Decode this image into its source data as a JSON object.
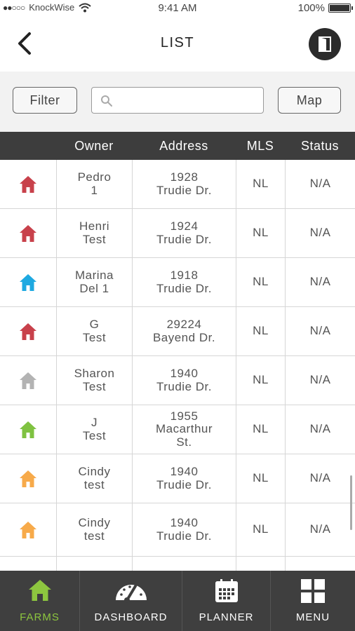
{
  "status_bar": {
    "signal": "●●○○○",
    "carrier": "KnockWise",
    "time": "9:41 AM",
    "battery": "100%"
  },
  "nav": {
    "title": "LIST",
    "back_icon": "chevron-left-icon",
    "action_icon": "door-icon"
  },
  "toolbar": {
    "filter_label": "Filter",
    "search_placeholder": "",
    "search_value": "",
    "map_label": "Map"
  },
  "table": {
    "columns": [
      "",
      "Owner",
      "Address",
      "MLS",
      "Status"
    ],
    "rows": [
      {
        "color": "#c8414b",
        "owner": "Pedro\n1",
        "address": "1928\nTrudie Dr.",
        "mls": "NL",
        "status": "N/A"
      },
      {
        "color": "#c8414b",
        "owner": "Henri\nTest",
        "address": "1924\nTrudie Dr.",
        "mls": "NL",
        "status": "N/A"
      },
      {
        "color": "#1ea9e1",
        "owner": "Marina\nDel 1",
        "address": "1918\nTrudie Dr.",
        "mls": "NL",
        "status": "N/A"
      },
      {
        "color": "#c8414b",
        "owner": "G\nTest",
        "address": "29224\nBayend Dr.",
        "mls": "NL",
        "status": "N/A"
      },
      {
        "color": "#b3b3b3",
        "owner": "Sharon\nTest",
        "address": "1940\nTrudie Dr.",
        "mls": "NL",
        "status": "N/A"
      },
      {
        "color": "#7fc241",
        "owner": "J\nTest",
        "address": "1955\nMacarthur\nSt.",
        "mls": "NL",
        "status": "N/A"
      },
      {
        "color": "#f7aa4a",
        "owner": "Cindy\ntest",
        "address": "1940\nTrudie Dr.",
        "mls": "NL",
        "status": "N/A"
      },
      {
        "color": "#f7aa4a",
        "owner": "Cindy\ntest",
        "address": "1940\nTrudie Dr.",
        "mls": "NL",
        "status": "N/A"
      },
      {
        "color": "#c8414b",
        "owner": "",
        "address": "",
        "mls": "",
        "status": ""
      }
    ]
  },
  "tabs": [
    {
      "label": "FARMS",
      "icon": "home-icon",
      "active": true,
      "color": "#8dc63f"
    },
    {
      "label": "DASHBOARD",
      "icon": "gauge-icon",
      "active": false
    },
    {
      "label": "PLANNER",
      "icon": "calendar-icon",
      "active": false
    },
    {
      "label": "MENU",
      "icon": "grid-icon",
      "active": false
    }
  ]
}
